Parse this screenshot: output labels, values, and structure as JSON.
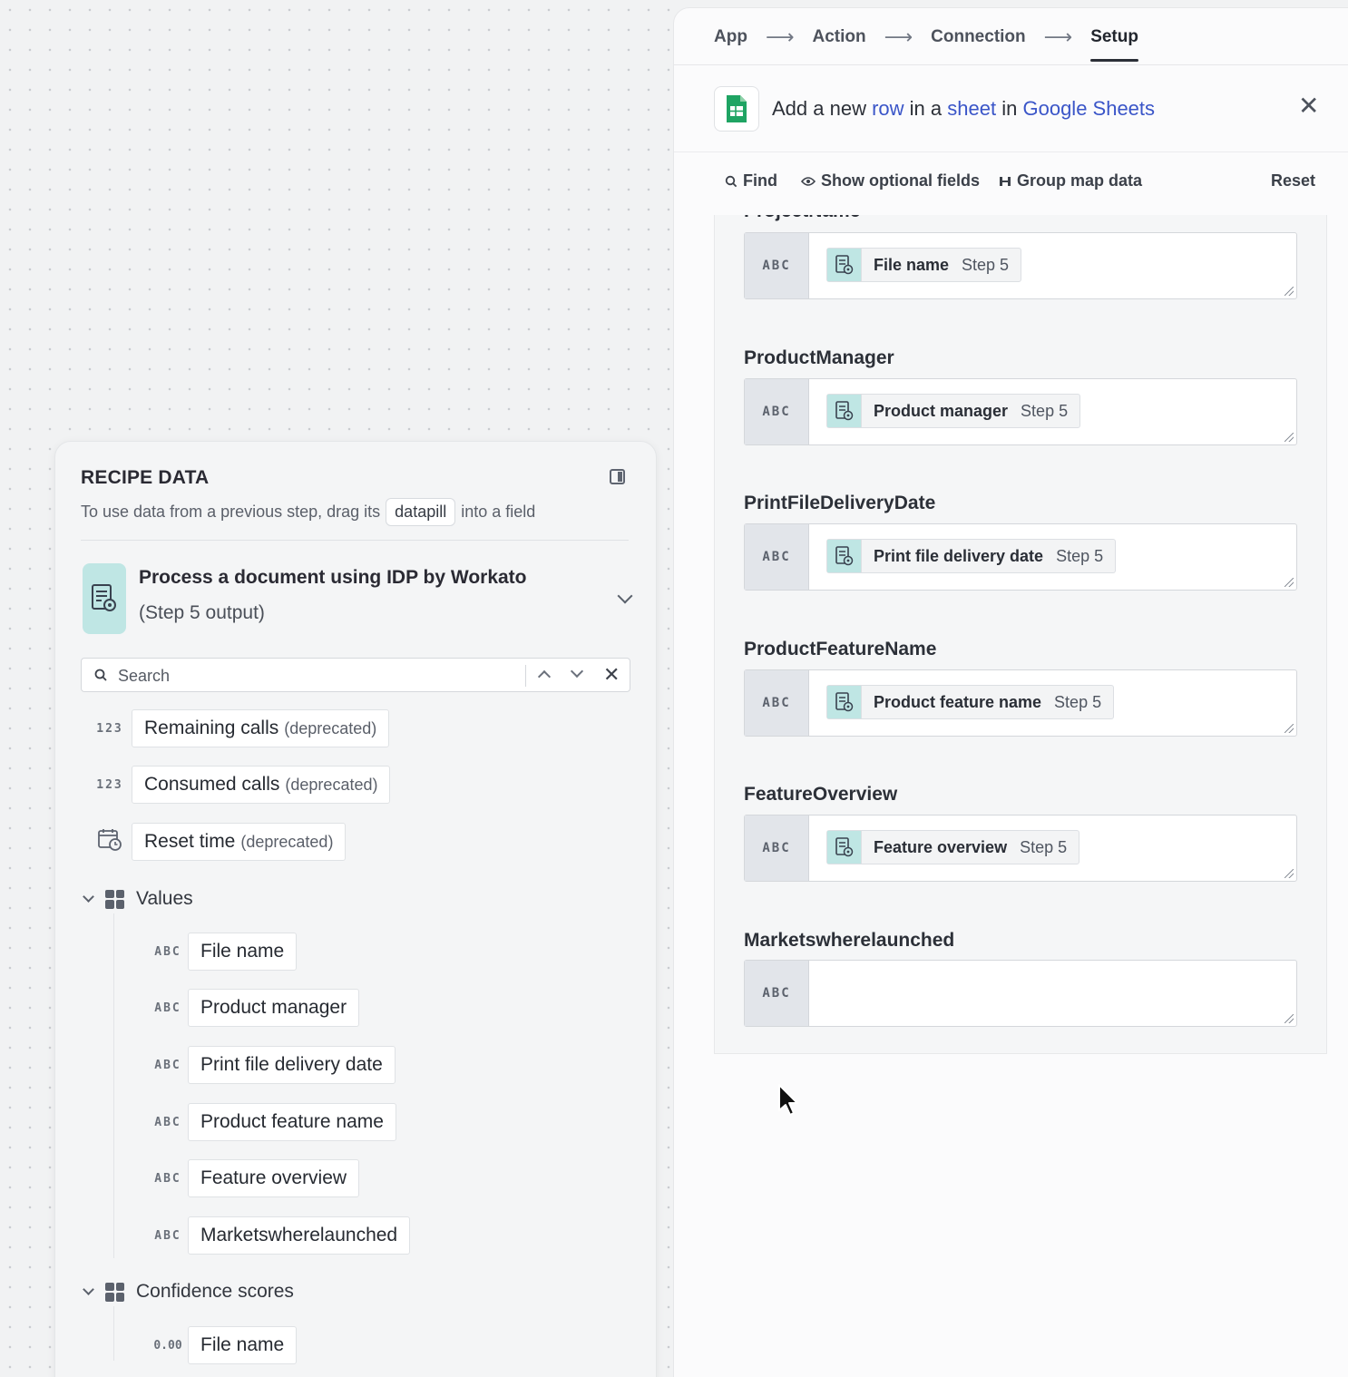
{
  "recipe_data": {
    "title": "RECIPE DATA",
    "hint_before": "To use data from a previous step, drag its",
    "hint_pill": "datapill",
    "hint_after": "into a field",
    "step": {
      "title": "Process a document using IDP by Workato",
      "subtitle": "(Step 5 output)"
    },
    "search_placeholder": "Search",
    "top_items": [
      {
        "type": "123",
        "label": "Remaining calls",
        "note": "(deprecated)"
      },
      {
        "type": "123",
        "label": "Consumed calls",
        "note": "(deprecated)"
      },
      {
        "type": "calendar-clock-icon",
        "label": "Reset time",
        "note": "(deprecated)"
      }
    ],
    "groups": [
      {
        "label": "Values",
        "items": [
          {
            "type": "ABC",
            "label": "File name"
          },
          {
            "type": "ABC",
            "label": "Product manager"
          },
          {
            "type": "ABC",
            "label": "Print file delivery date"
          },
          {
            "type": "ABC",
            "label": "Product feature name"
          },
          {
            "type": "ABC",
            "label": "Feature overview"
          },
          {
            "type": "ABC",
            "label": "Marketswherelaunched"
          }
        ]
      },
      {
        "label": "Confidence scores",
        "items": [
          {
            "type": "0.00",
            "label": "File name"
          }
        ]
      }
    ]
  },
  "setup": {
    "nav": [
      "App",
      "Action",
      "Connection",
      "Setup"
    ],
    "nav_arrow": "⟶",
    "active_step": "Setup",
    "action_title": {
      "prefix": "Add a new",
      "obj": "row",
      "mid": "in a",
      "container": "sheet",
      "in": "in",
      "app": "Google Sheets"
    },
    "close_symbol": "✕",
    "toolbar": {
      "find": "Find",
      "show_optional": "Show optional fields",
      "group_map": "Group map data",
      "reset": "Reset"
    },
    "fields": [
      {
        "label": "ProjectName",
        "type": "ABC",
        "pill": "File name",
        "step": "Step 5"
      },
      {
        "label": "ProductManager",
        "type": "ABC",
        "pill": "Product manager",
        "step": "Step 5"
      },
      {
        "label": "PrintFileDeliveryDate",
        "type": "ABC",
        "pill": "Print file delivery date",
        "step": "Step 5"
      },
      {
        "label": "ProductFeatureName",
        "type": "ABC",
        "pill": "Product feature name",
        "step": "Step 5"
      },
      {
        "label": "FeatureOverview",
        "type": "ABC",
        "pill": "Feature overview",
        "step": "Step 5"
      },
      {
        "label": "Marketswherelaunched",
        "type": "ABC",
        "pill": "",
        "step": ""
      }
    ]
  },
  "colors": {
    "link": "#3a55c8",
    "idp_icon_bg": "#bfe6e4",
    "sheets_green": "#1fa463"
  }
}
